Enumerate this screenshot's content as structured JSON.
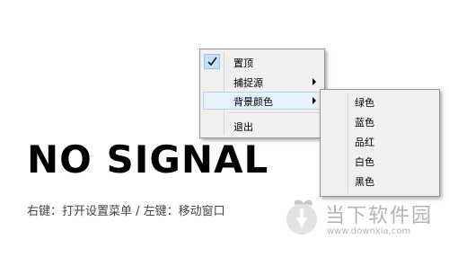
{
  "display": {
    "signal_text": "NO SIGNAL",
    "hint_text": "右键：打开设置菜单 / 左键：移动窗口"
  },
  "context_menu": {
    "items": [
      {
        "label": "置顶",
        "checked": true,
        "has_submenu": false
      },
      {
        "label": "捕捉源",
        "checked": false,
        "has_submenu": true
      },
      {
        "label": "背景颜色",
        "checked": false,
        "has_submenu": true,
        "highlighted": true
      },
      {
        "label": "退出",
        "checked": false,
        "has_submenu": false
      }
    ]
  },
  "background_color_submenu": {
    "items": [
      {
        "label": "绿色"
      },
      {
        "label": "蓝色"
      },
      {
        "label": "品红"
      },
      {
        "label": "白色"
      },
      {
        "label": "黑色"
      }
    ]
  },
  "watermark": {
    "brand_text": "当下软件园",
    "url_text": "www.downxia.com"
  },
  "colors": {
    "menu_background": "#f0f0f0",
    "highlight": "#e5f1fb",
    "check_background": "#c5dff5",
    "watermark": "#b4b4b4"
  }
}
